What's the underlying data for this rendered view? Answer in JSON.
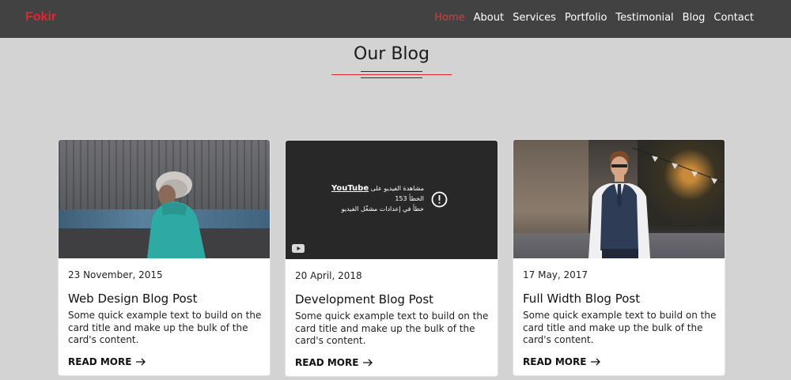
{
  "nav": {
    "brand": "Fokir",
    "links": [
      "Home",
      "About",
      "Services",
      "Portfolio",
      "Testimonial",
      "Blog",
      "Contact"
    ],
    "active": "Home",
    "brand_color": "#e0262f",
    "bar_color": "#424242"
  },
  "section": {
    "title": "Our Blog",
    "accent_color": "#e0262f"
  },
  "cards": [
    {
      "date": "23 November, 2015",
      "title": "Web Design Blog Post",
      "text": "Some quick example text to build on the card title and make up the bulk of the card's content.",
      "read_more": "READ MORE",
      "media": "photo-person-teal-jacket"
    },
    {
      "date": "20 April, 2018",
      "title": "Development Blog Post",
      "text": "Some quick example text to build on the card title and make up the bulk of the card's content.",
      "read_more": "READ MORE",
      "media": "embedded-video-unavailable",
      "video": {
        "line1": "مشاهدة الفيديو على",
        "youtube": "YouTube",
        "line2": "الخطأ 153",
        "line3": "خطأ في إعدادات مشغّل الفيديو",
        "alert_icon": "alert-circle-icon",
        "logo_icon": "youtube-logo-icon"
      }
    },
    {
      "date": "17 May, 2017",
      "title": "Full Width Blog Post",
      "text": "Some quick example text to build on the card title and make up the bulk of the card's content.",
      "read_more": "READ MORE",
      "media": "photo-man-vest-street"
    }
  ]
}
